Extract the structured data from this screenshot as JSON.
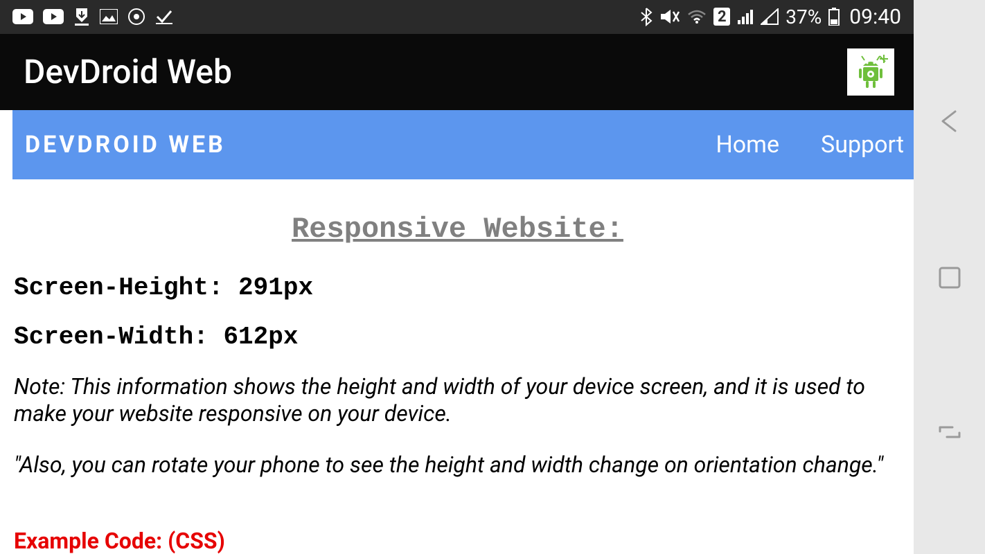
{
  "statusBar": {
    "simBadge": "2",
    "battery": "37%",
    "time": "09:40"
  },
  "appBar": {
    "title": "DevDroid Web"
  },
  "webNav": {
    "brand": "DEVDROID WEB",
    "links": {
      "home": "Home",
      "support": "Support"
    }
  },
  "content": {
    "heading": "Responsive Website:",
    "screenHeight": "Screen-Height: 291px",
    "screenWidth": "Screen-Width: 612px",
    "note1": "Note: This information shows the height and width of your device screen, and it is used to make your website responsive on your device.",
    "note2": "\"Also, you can rotate your phone to see the height and width change on orientation change.\"",
    "codeHeading": "Example Code: (CSS)"
  }
}
